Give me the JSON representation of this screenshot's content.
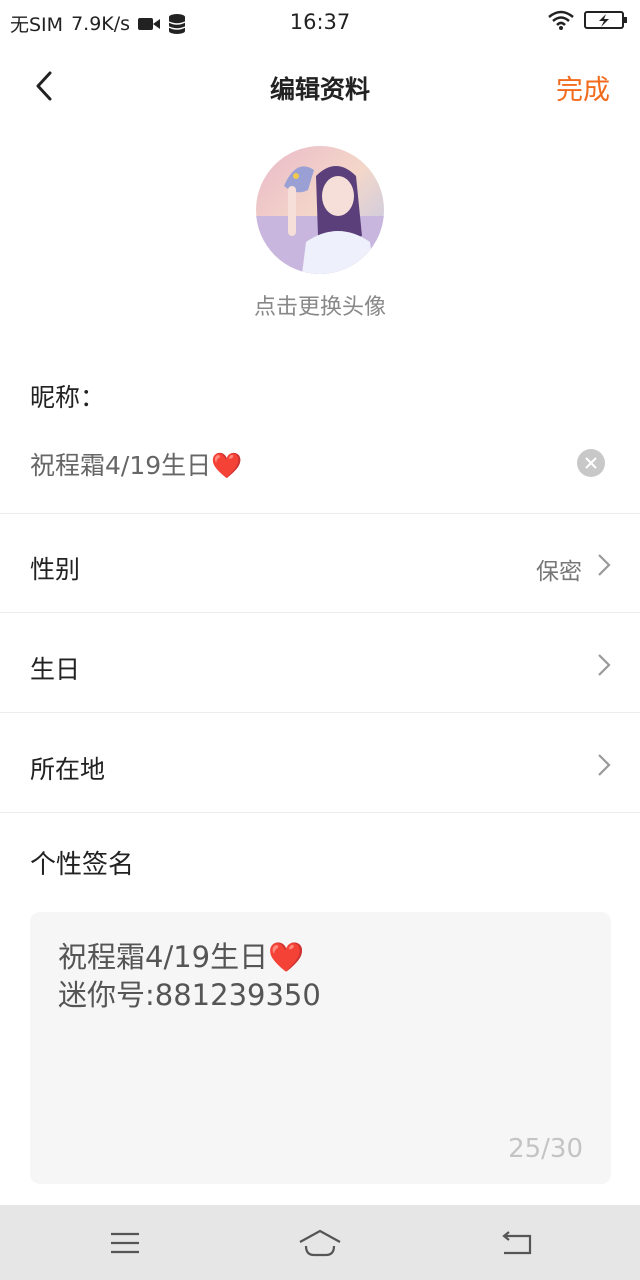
{
  "status_bar": {
    "carrier": "无SIM",
    "speed": "7.9K/s",
    "time": "16:37",
    "icons": [
      "video-camera-icon",
      "database-icon",
      "wifi-icon",
      "battery-charging-icon"
    ]
  },
  "header": {
    "title": "编辑资料",
    "done_label": "完成",
    "back_icon": "back-arrow-icon"
  },
  "avatar": {
    "hint": "点击更换头像"
  },
  "nickname": {
    "label": "昵称：",
    "value": "祝程霜4/19生日❤️"
  },
  "rows": [
    {
      "label": "性别",
      "value": "保密"
    },
    {
      "label": "生日",
      "value": ""
    },
    {
      "label": "所在地",
      "value": ""
    }
  ],
  "signature": {
    "label": "个性签名",
    "text": "祝程霜4/19生日❤️\n迷你号:881239350",
    "count": "25/30"
  },
  "nav_bar": {
    "icons": [
      "menu-icon",
      "home-icon",
      "back-icon"
    ]
  },
  "colors": {
    "accent": "#f26b1d",
    "nav_bg": "#e6e6e6",
    "sig_bg": "#f6f6f6"
  }
}
